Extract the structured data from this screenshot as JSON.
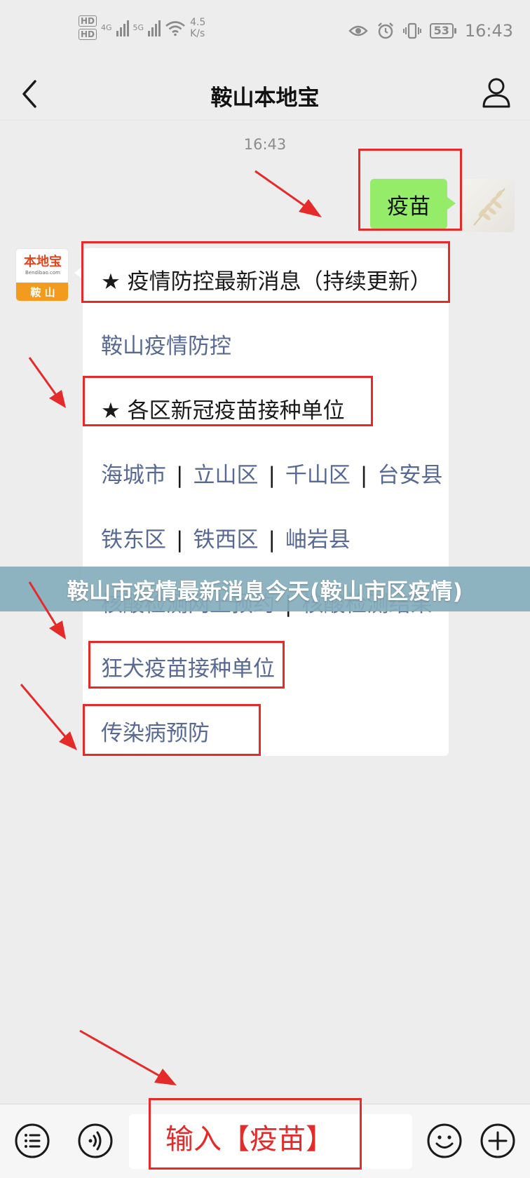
{
  "status_bar": {
    "hd1": "HD",
    "hd2": "HD",
    "net1": "4G",
    "net2": "5G",
    "speed_value": "4.5",
    "speed_unit": "K/s",
    "battery": "53",
    "time": "16:43"
  },
  "nav": {
    "title": "鞍山本地宝"
  },
  "chat": {
    "timestamp": "16:43",
    "sent_message": "疫苗",
    "bot_avatar": {
      "brand": "本地宝",
      "url": "Bendibao.com",
      "city": "鞍 山"
    },
    "menu": {
      "item1": "★ 疫情防控最新消息（持续更新）",
      "item2": "鞍山疫情防控",
      "item3": "★ 各区新冠疫苗接种单位",
      "districts_row1": [
        "海城市",
        "立山区",
        "千山区",
        "台安县"
      ],
      "districts_row2": [
        "铁东区",
        "铁西区",
        "岫岩县"
      ],
      "testing_row": [
        "核酸检测网上预约",
        "核酸检测结果"
      ],
      "item_rabies": "狂犬疫苗接种单位",
      "item_infectious": "传染病预防",
      "separator": "|"
    }
  },
  "banner": {
    "text": "鞍山市疫情最新消息今天(鞍山市区疫情)"
  },
  "input_bar": {
    "hint": "输入【疫苗】"
  },
  "colors": {
    "accent_green": "#95ec69",
    "link_blue": "#586a94",
    "annotation_red": "#e52a2a"
  },
  "icons": [
    "back-arrow-icon",
    "profile-icon",
    "menu-list-icon",
    "voice-icon",
    "emoji-icon",
    "plus-icon"
  ]
}
